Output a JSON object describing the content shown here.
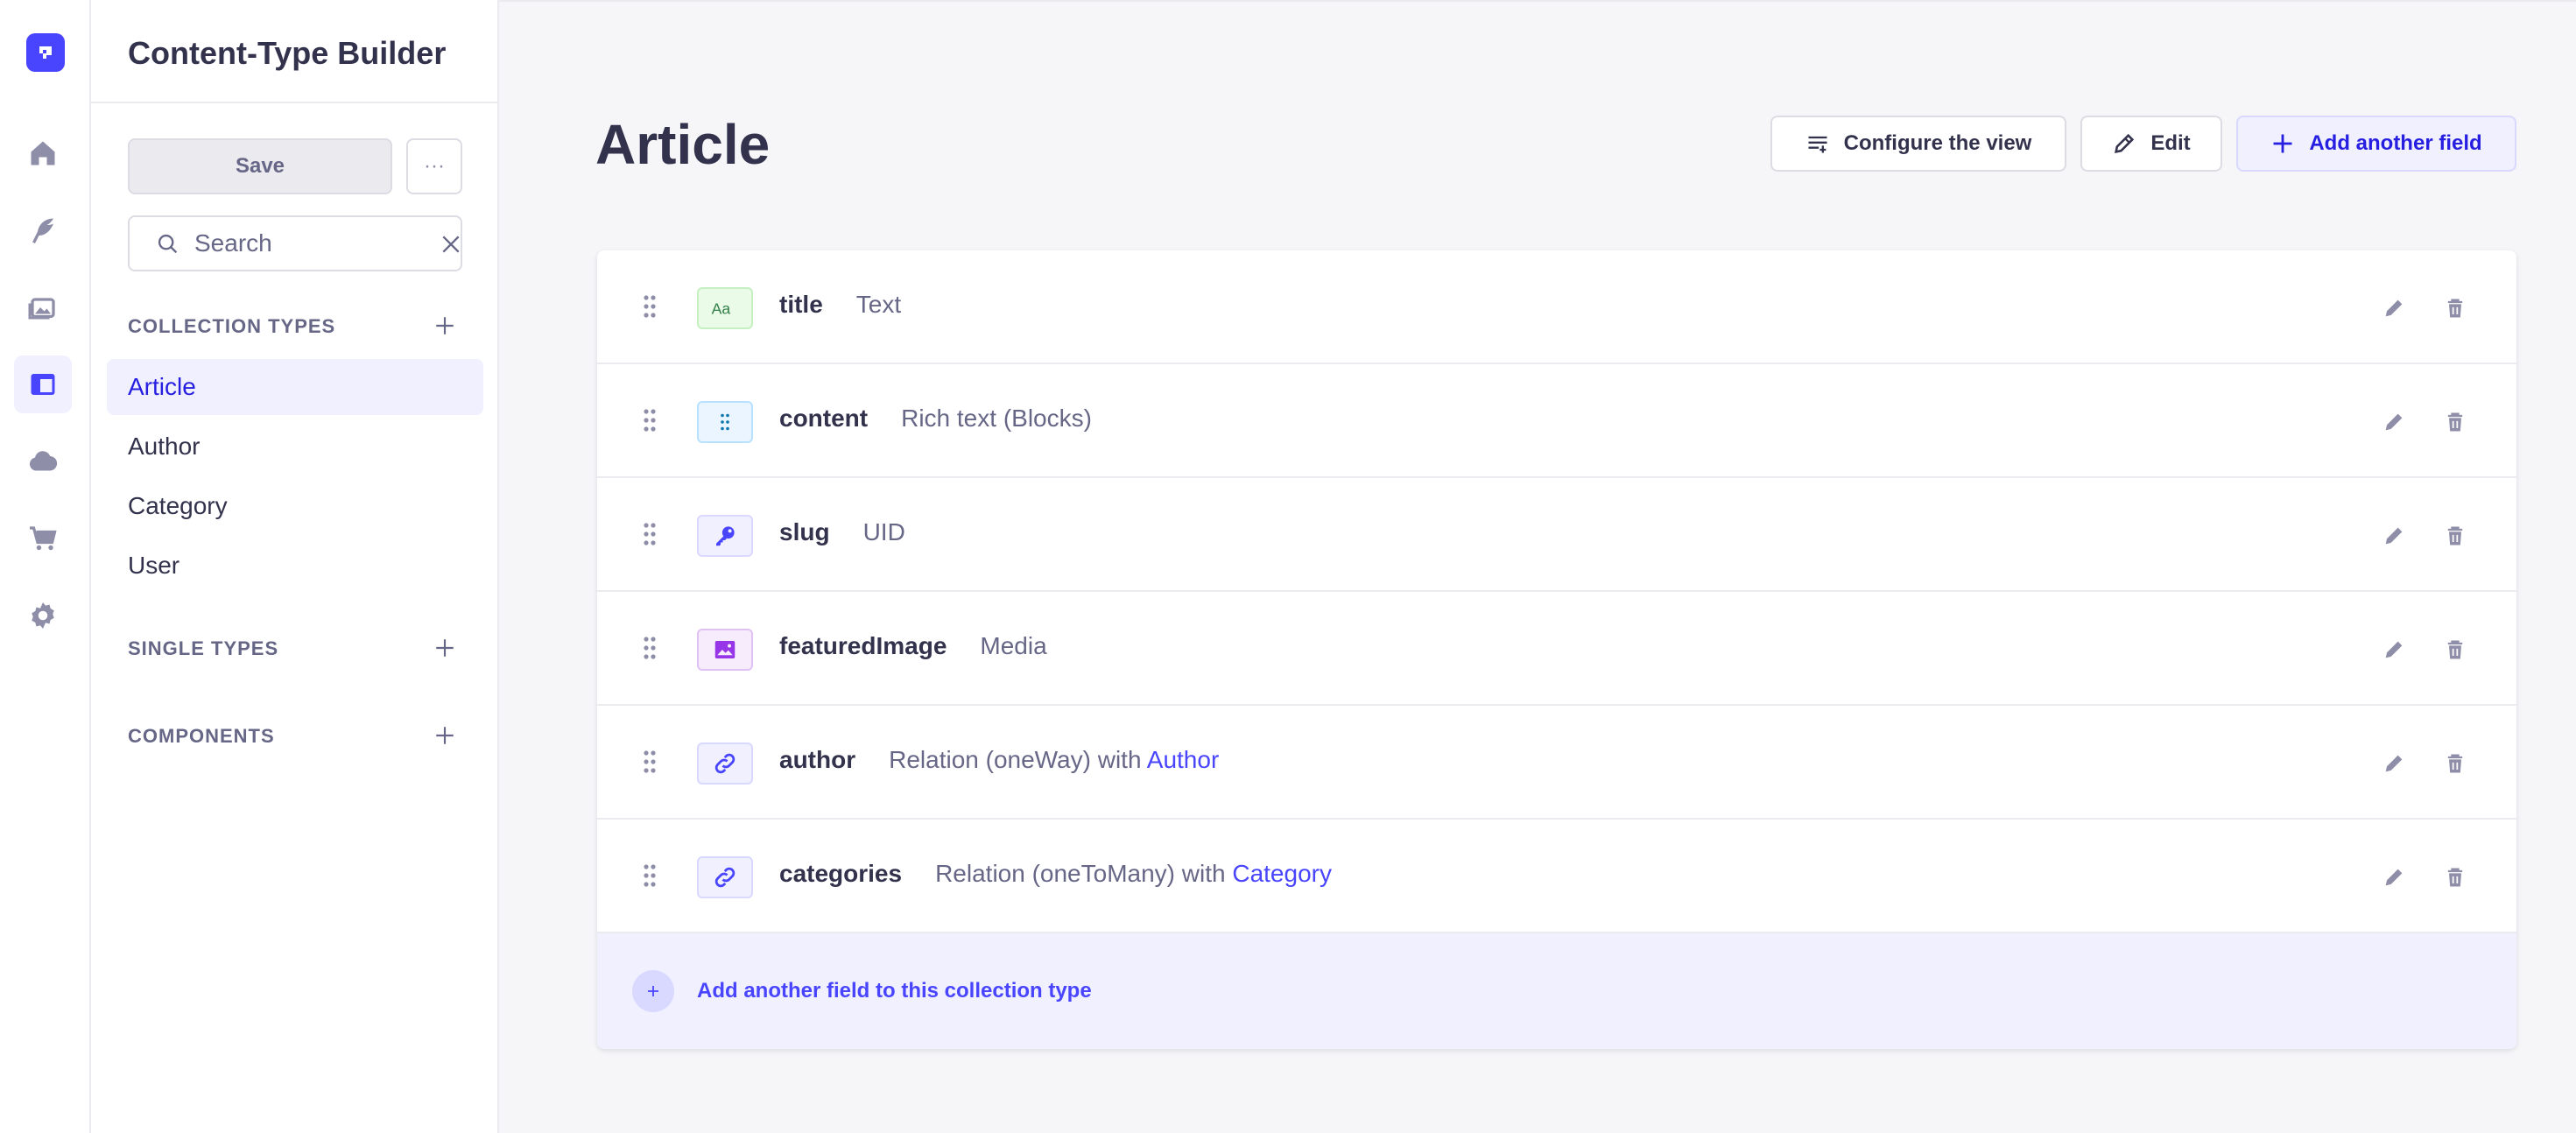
{
  "colors": {
    "primary": "#4945ff",
    "primary_dark": "#271fe0",
    "primary_light": "#f0f0ff",
    "neutral_text": "#32324d",
    "muted_text": "#666687",
    "page_bg": "#f6f6f9"
  },
  "rail": {
    "items": [
      {
        "icon": "home-icon"
      },
      {
        "icon": "feather-icon"
      },
      {
        "icon": "image-icon"
      },
      {
        "icon": "layout-icon",
        "active": true
      },
      {
        "icon": "cloud-icon"
      },
      {
        "icon": "cart-icon"
      },
      {
        "icon": "gear-icon"
      }
    ]
  },
  "sidebar": {
    "title": "Content-Type Builder",
    "save_label": "Save",
    "more_label": "···",
    "search": {
      "placeholder": "Search",
      "value": ""
    },
    "sections": [
      {
        "label": "COLLECTION TYPES",
        "items": [
          "Article",
          "Author",
          "Category",
          "User"
        ],
        "active": "Article"
      },
      {
        "label": "SINGLE TYPES",
        "items": []
      },
      {
        "label": "COMPONENTS",
        "items": []
      }
    ]
  },
  "main": {
    "title": "Article",
    "buttons": {
      "configure": "Configure the view",
      "edit": "Edit",
      "add": "Add another field"
    },
    "fields": [
      {
        "name": "title",
        "type": "Text",
        "icon": "text-icon"
      },
      {
        "name": "content",
        "type": "Rich text (Blocks)",
        "icon": "blocks-icon"
      },
      {
        "name": "slug",
        "type": "UID",
        "icon": "key-icon"
      },
      {
        "name": "featuredImage",
        "type": "Media",
        "icon": "media-icon"
      },
      {
        "name": "author",
        "type": "Relation (oneWay) with ",
        "target": "Author",
        "icon": "relation-icon"
      },
      {
        "name": "categories",
        "type": "Relation (oneToMany) with ",
        "target": "Category",
        "icon": "relation-icon"
      }
    ],
    "add_field_label": "Add another field to this collection type"
  }
}
